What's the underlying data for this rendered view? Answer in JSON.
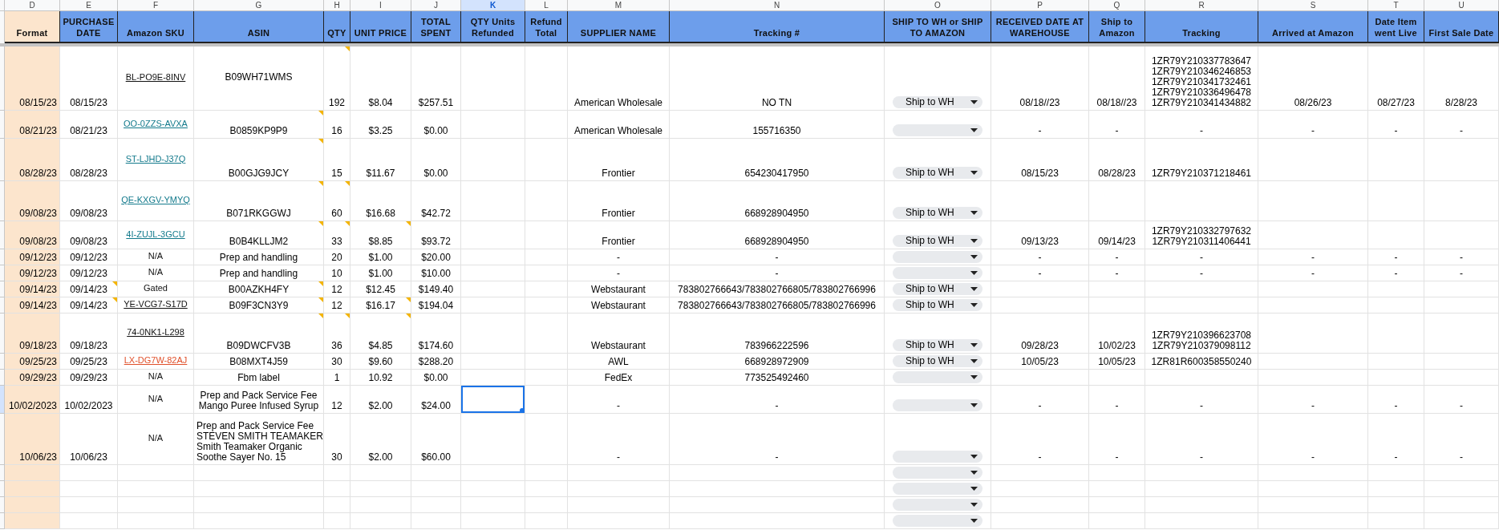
{
  "columns": [
    {
      "letter": "D",
      "selected": false
    },
    {
      "letter": "E",
      "selected": false
    },
    {
      "letter": "F",
      "selected": false
    },
    {
      "letter": "G",
      "selected": false
    },
    {
      "letter": "H",
      "selected": false
    },
    {
      "letter": "I",
      "selected": false
    },
    {
      "letter": "J",
      "selected": false
    },
    {
      "letter": "K",
      "selected": true
    },
    {
      "letter": "L",
      "selected": false
    },
    {
      "letter": "M",
      "selected": false
    },
    {
      "letter": "N",
      "selected": false
    },
    {
      "letter": "O",
      "selected": false
    },
    {
      "letter": "P",
      "selected": false
    },
    {
      "letter": "Q",
      "selected": false
    },
    {
      "letter": "R",
      "selected": false
    },
    {
      "letter": "S",
      "selected": false
    },
    {
      "letter": "T",
      "selected": false
    },
    {
      "letter": "U",
      "selected": false
    }
  ],
  "headers": [
    "Format",
    "PURCHASE DATE",
    "Amazon SKU",
    "ASIN",
    "QTY",
    "UNIT PRICE",
    "TOTAL SPENT",
    "QTY Units Refunded",
    "Refund Total",
    "SUPPLIER NAME",
    "Tracking #",
    "SHIP TO WH or SHIP TO AMAZON",
    "RECEIVED DATE AT WAREHOUSE",
    "Ship to Amazon",
    "Tracking",
    "Arrived at Amazon",
    "Date Item went Live",
    "First Sale Date"
  ],
  "rows": [
    {
      "selected": false,
      "cells": [
        "08/15/23",
        "08/15/23",
        {
          "text": "BL-PO9E-8INV",
          "link": true,
          "color": "#111111"
        },
        "B09WH71WMS",
        {
          "text": "192",
          "comment": true
        },
        "$8.04",
        "$257.51",
        null,
        null,
        "American Wholesale",
        "NO TN",
        "Ship to WH",
        "08/18//23",
        "08/18//23",
        "1ZR79Y210337783647\n1ZR79Y210346246853\n1ZR79Y210341732461\n1ZR79Y210336496478\n1ZR79Y210341434882",
        "08/26/23",
        "08/27/23",
        "8/28/23"
      ]
    },
    {
      "selected": false,
      "cells": [
        "08/21/23",
        "08/21/23",
        {
          "text": "OO-0ZZS-AVXA",
          "link": true,
          "color": "#137a8c"
        },
        {
          "text": "B0859KP9P9",
          "comment": true
        },
        "16",
        "$3.25",
        "$0.00",
        null,
        null,
        "American Wholesale",
        "155716350",
        null,
        "-",
        "-",
        "-",
        "-",
        "-",
        "-"
      ]
    },
    {
      "selected": false,
      "cells": [
        "08/28/23",
        "08/28/23",
        {
          "text": "ST-LJHD-J37Q",
          "link": true,
          "color": "#137a8c"
        },
        {
          "text": "B00GJG9JCY",
          "comment": true
        },
        "15",
        "$11.67",
        "$0.00",
        null,
        null,
        "Frontier",
        "654230417950",
        "Ship to WH",
        "08/15/23",
        "08/28/23",
        "1ZR79Y210371218461",
        null,
        null,
        null
      ]
    },
    {
      "selected": false,
      "cells": [
        "09/08/23",
        "09/08/23",
        {
          "text": "QE-KXGV-YMYQ",
          "link": true,
          "color": "#137a8c"
        },
        {
          "text": "B071RKGGWJ",
          "comment": true
        },
        {
          "text": "60",
          "comment": true
        },
        "$16.68",
        "$42.72",
        null,
        null,
        "Frontier",
        "668928904950",
        "Ship to WH",
        null,
        null,
        null,
        null,
        null,
        null
      ]
    },
    {
      "selected": false,
      "cells": [
        "09/08/23",
        "09/08/23",
        {
          "text": "4I-ZUJL-3GCU",
          "link": true,
          "color": "#137a8c"
        },
        {
          "text": "B0B4KLLJM2",
          "comment": true
        },
        {
          "text": "33",
          "comment": true
        },
        {
          "text": "$8.85",
          "comment": true
        },
        "$93.72",
        null,
        null,
        "Frontier",
        "668928904950",
        "Ship to WH",
        "09/13/23",
        "09/14/23",
        "1ZR79Y210332797632\n1ZR79Y210311406441",
        null,
        null,
        null
      ]
    },
    {
      "selected": false,
      "cells": [
        "09/12/23",
        "09/12/23",
        "N/A",
        "Prep and handling",
        "20",
        "$1.00",
        "$20.00",
        null,
        null,
        "-",
        "-",
        null,
        "-",
        "-",
        "-",
        "-",
        "-",
        "-"
      ]
    },
    {
      "selected": false,
      "cells": [
        "09/12/23",
        "09/12/23",
        "N/A",
        "Prep and handling",
        "10",
        "$1.00",
        "$10.00",
        null,
        null,
        "-",
        "-",
        null,
        "-",
        "-",
        "-",
        "-",
        "-",
        "-"
      ]
    },
    {
      "selected": false,
      "cells": [
        "09/14/23",
        {
          "text": "09/14/23",
          "comment": true
        },
        "Gated",
        {
          "text": "B00AZKH4FY",
          "comment": true
        },
        "12",
        "$12.45",
        "$149.40",
        null,
        null,
        "Webstaurant",
        "783802766643/783802766805/783802766996",
        "Ship to WH",
        null,
        null,
        null,
        null,
        null,
        null
      ]
    },
    {
      "selected": false,
      "cells": [
        "09/14/23",
        {
          "text": "09/14/23",
          "comment": true
        },
        {
          "text": "YE-VCG7-S17D",
          "link": true,
          "color": "#111111"
        },
        {
          "text": "B09F3CN3Y9",
          "comment": true
        },
        "12",
        {
          "text": "$16.17",
          "comment": true
        },
        "$194.04",
        null,
        null,
        "Webstaurant",
        "783802766643/783802766805/783802766996",
        "Ship to WH",
        null,
        null,
        null,
        null,
        null,
        null
      ]
    },
    {
      "selected": false,
      "cells": [
        "09/18/23",
        "09/18/23",
        {
          "text": "74-0NK1-L298",
          "link": true,
          "color": "#111111"
        },
        {
          "text": "B09DWCFV3B",
          "comment": true
        },
        {
          "text": "36",
          "comment": true
        },
        {
          "text": "$4.85",
          "comment": true
        },
        "$174.60",
        null,
        null,
        "Webstaurant",
        "783966222596",
        "Ship to WH",
        "09/28/23",
        "10/02/23",
        "1ZR79Y210396623708\n1ZR79Y210379098112",
        null,
        null,
        null
      ]
    },
    {
      "selected": false,
      "cells": [
        "09/25/23",
        "09/25/23",
        {
          "text": "LX-DG7W-82AJ",
          "link": true,
          "color": "#e0502a"
        },
        "B08MXT4J59",
        "30",
        "$9.60",
        "$288.20",
        null,
        null,
        "AWL",
        "668928972909",
        "Ship to WH",
        "10/05/23",
        "10/05/23",
        "1ZR81R600358550240",
        null,
        null,
        null
      ]
    },
    {
      "selected": false,
      "cells": [
        "09/29/23",
        "09/29/23",
        "N/A",
        "Fbm label",
        "1",
        "10.92",
        "$0.00",
        null,
        null,
        "FedEx",
        "773525492460",
        null,
        null,
        null,
        null,
        null,
        null,
        null
      ]
    },
    {
      "selected": true,
      "cells": [
        "10/02/2023",
        "10/02/2023",
        "N/A",
        "Prep and Pack Service Fee\nMango Puree Infused Syrup",
        "12",
        "$2.00",
        "$24.00",
        null,
        null,
        "-",
        "-",
        null,
        "-",
        "-",
        "-",
        "-",
        "-",
        "-"
      ]
    },
    {
      "selected": false,
      "cells": [
        "10/06/23",
        "10/06/23",
        "N/A",
        "Prep and Pack Service Fee\nSTEVEN SMITH TEAMAKER\nSmith Teamaker Organic\nSoothe Sayer No. 15",
        "30",
        "$2.00",
        "$60.00",
        null,
        null,
        "-",
        "-",
        null,
        "-",
        "-",
        "-",
        "-",
        "-",
        "-"
      ]
    },
    {
      "selected": false,
      "cells": [
        null,
        null,
        null,
        null,
        null,
        null,
        null,
        null,
        null,
        null,
        null,
        null,
        null,
        null,
        null,
        null,
        null,
        null
      ]
    },
    {
      "selected": false,
      "cells": [
        null,
        null,
        null,
        null,
        null,
        null,
        null,
        null,
        null,
        null,
        null,
        null,
        null,
        null,
        null,
        null,
        null,
        null
      ]
    },
    {
      "selected": false,
      "cells": [
        null,
        null,
        null,
        null,
        null,
        null,
        null,
        null,
        null,
        null,
        null,
        null,
        null,
        null,
        null,
        null,
        null,
        null
      ]
    },
    {
      "selected": false,
      "cells": [
        null,
        null,
        null,
        null,
        null,
        null,
        null,
        null,
        null,
        null,
        null,
        null,
        null,
        null,
        null,
        null,
        null,
        null
      ]
    }
  ]
}
